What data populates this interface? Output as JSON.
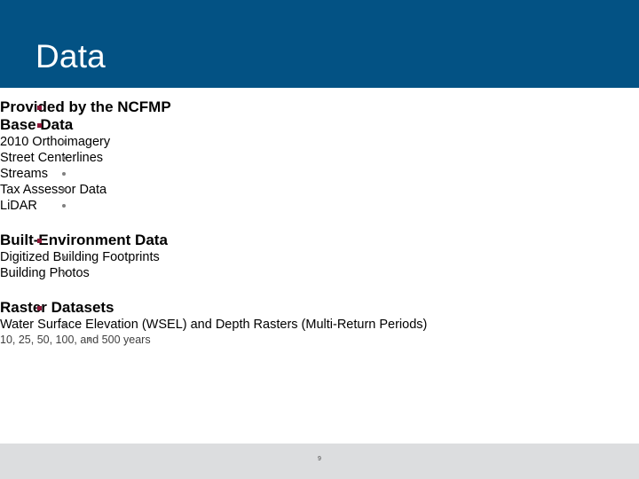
{
  "slide": {
    "title": "Data",
    "header_color": "#035284",
    "background_color": "#ffffff",
    "footer_color": "#dcdddf",
    "level1_marker_color": "#8C1838",
    "level2_marker_color": "#808080",
    "level3_marker_color": "#9a9a9a",
    "page_number": "9"
  },
  "content": {
    "items": [
      {
        "level": 1,
        "text": "Provided by the NCFMP"
      },
      {
        "level": 1,
        "text": "Base Data"
      },
      {
        "level": 2,
        "text": "2010 Orthoimagery"
      },
      {
        "level": 2,
        "text": "Street Centerlines"
      },
      {
        "level": 2,
        "text": "Streams"
      },
      {
        "level": 2,
        "text": "Tax Assessor Data"
      },
      {
        "level": 2,
        "text": "LiDAR"
      },
      {
        "level": 1,
        "text": "Built-Environment Data"
      },
      {
        "level": 2,
        "text": "Digitized Building Footprints"
      },
      {
        "level": 2,
        "text": "Building Photos"
      },
      {
        "level": 1,
        "text": "Raster Datasets"
      },
      {
        "level": 2,
        "text": "Water Surface Elevation (WSEL) and Depth Rasters (Multi-Return Periods)"
      },
      {
        "level": 3,
        "text": "10, 25, 50, 100, and 500 years"
      }
    ]
  }
}
